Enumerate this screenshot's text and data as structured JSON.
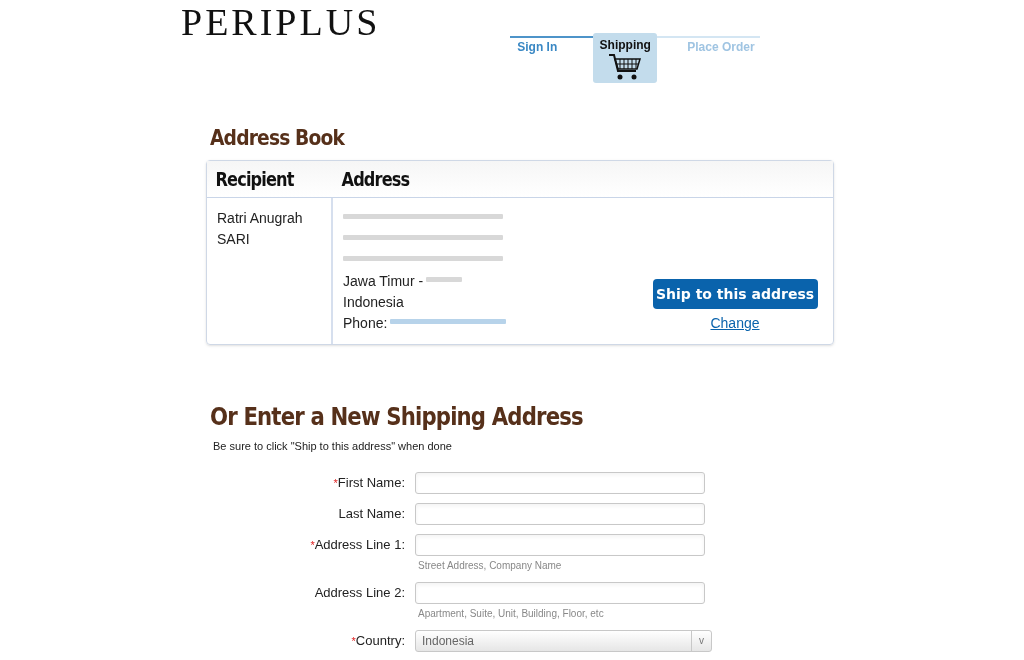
{
  "logo": "PERIPLUS",
  "steps": [
    {
      "label": "Sign In",
      "selected": false,
      "completed": true
    },
    {
      "label": "Shipping",
      "selected": true,
      "completed": false
    },
    {
      "label": "Place Order",
      "selected": false,
      "completed": false
    }
  ],
  "address_book": {
    "title": "Address Book",
    "columns": [
      "Recipient",
      "Address"
    ],
    "entries": [
      {
        "recipient": "Ratri Anugrah SARI",
        "lines": [
          {
            "kind": "redacted"
          },
          {
            "kind": "redacted"
          },
          {
            "kind": "redacted"
          },
          {
            "kind": "text",
            "text": "Jawa Timur -",
            "redacted_tail": true
          },
          {
            "kind": "text",
            "text": "Indonesia",
            "redacted_tail": false
          },
          {
            "kind": "phone",
            "text": "Phone:"
          }
        ],
        "ship_button": "Ship to this address",
        "change_link": "Change"
      }
    ]
  },
  "new_address": {
    "title": "Or Enter a New Shipping Address",
    "note": "Be sure to click \"Ship to this address\" when done",
    "fields": [
      {
        "label": "First Name:",
        "required_mark": "*",
        "kind": "text"
      },
      {
        "label": "Last Name:",
        "kind": "text"
      },
      {
        "label": "Address Line 1:",
        "required_mark": "*",
        "kind": "text",
        "hint": "Street Address, Company Name"
      },
      {
        "label": "Address Line 2:",
        "kind": "text",
        "hint": "Apartment, Suite, Unit, Building, Floor, etc"
      },
      {
        "label": "Country:",
        "required_mark": "*",
        "kind": "select",
        "value": "Indonesia",
        "caret": "v"
      }
    ]
  }
}
